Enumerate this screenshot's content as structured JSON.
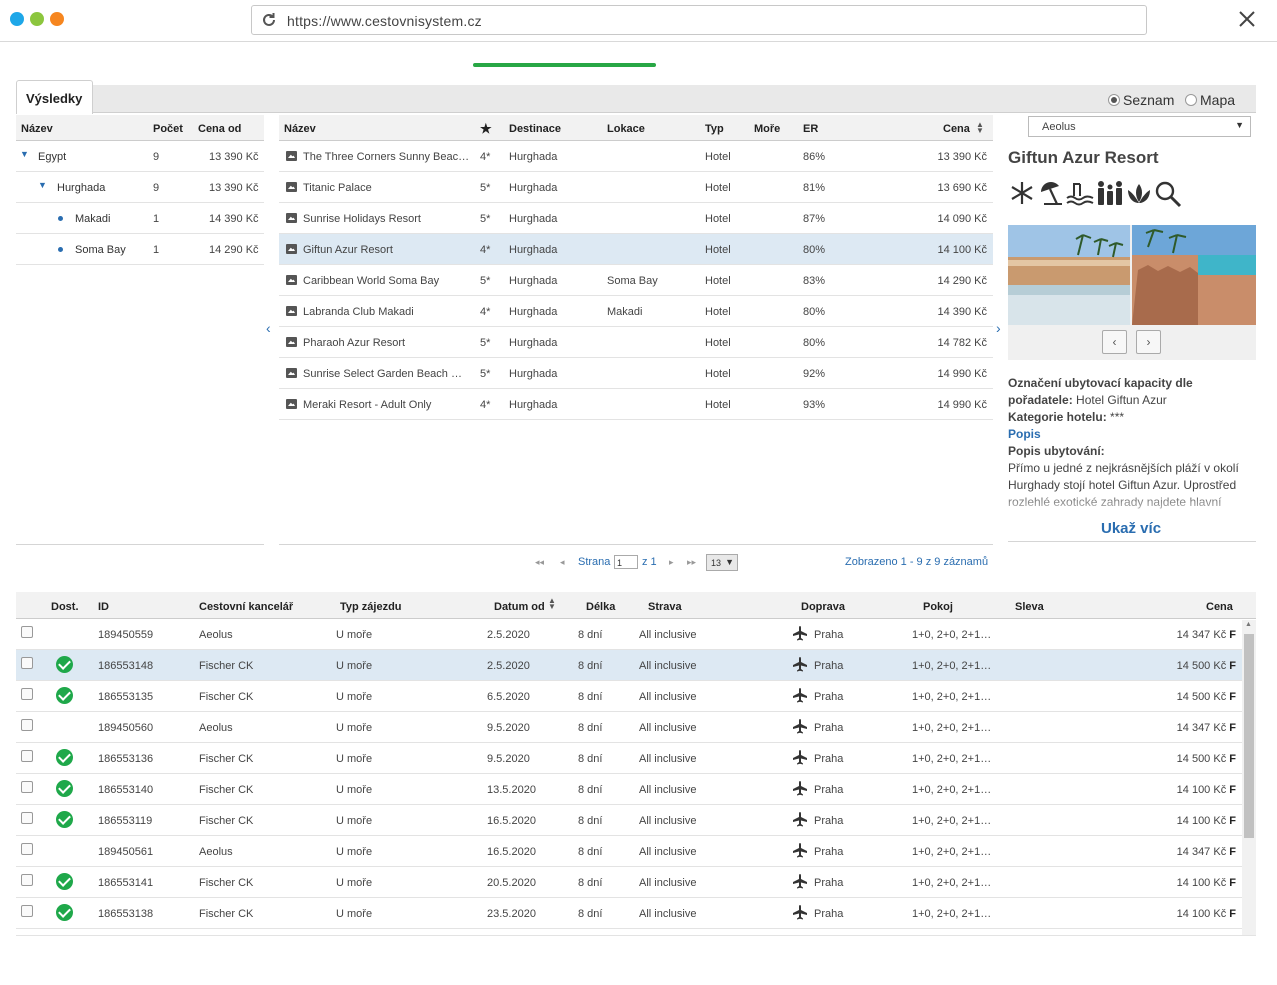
{
  "browser": {
    "url": "https://www.cestovnisystem.cz"
  },
  "tabs": {
    "results": "Výsledky"
  },
  "view": {
    "list": "Seznam",
    "map": "Mapa",
    "selected": "Seznam"
  },
  "destinations": {
    "headers": {
      "name": "Název",
      "count": "Počet",
      "price_from": "Cena od"
    },
    "rows": [
      {
        "name": "Egypt",
        "count": "9",
        "price": "13 390 Kč"
      },
      {
        "name": "Hurghada",
        "count": "9",
        "price": "13 390 Kč"
      },
      {
        "name": "Makadi",
        "count": "1",
        "price": "14 390 Kč"
      },
      {
        "name": "Soma Bay",
        "count": "1",
        "price": "14 290 Kč"
      }
    ]
  },
  "hotels": {
    "headers": {
      "name": "Název",
      "dest": "Destinace",
      "loc": "Lokace",
      "type": "Typ",
      "sea": "Moře",
      "er": "ER",
      "price": "Cena"
    },
    "rows": [
      {
        "name": "The Three Corners Sunny Beac…",
        "stars": "4*",
        "dest": "Hurghada",
        "loc": "",
        "type": "Hotel",
        "er": "86%",
        "price": "13 390 Kč"
      },
      {
        "name": "Titanic Palace",
        "stars": "5*",
        "dest": "Hurghada",
        "loc": "",
        "type": "Hotel",
        "er": "81%",
        "price": "13 690 Kč"
      },
      {
        "name": "Sunrise Holidays Resort",
        "stars": "5*",
        "dest": "Hurghada",
        "loc": "",
        "type": "Hotel",
        "er": "87%",
        "price": "14 090 Kč"
      },
      {
        "name": "Giftun Azur Resort",
        "stars": "4*",
        "dest": "Hurghada",
        "loc": "",
        "type": "Hotel",
        "er": "80%",
        "price": "14 100 Kč"
      },
      {
        "name": "Caribbean World Soma Bay",
        "stars": "5*",
        "dest": "Hurghada",
        "loc": "Soma Bay",
        "type": "Hotel",
        "er": "83%",
        "price": "14 290 Kč"
      },
      {
        "name": "Labranda Club Makadi",
        "stars": "4*",
        "dest": "Hurghada",
        "loc": "Makadi",
        "type": "Hotel",
        "er": "80%",
        "price": "14 390 Kč"
      },
      {
        "name": "Pharaoh Azur Resort",
        "stars": "5*",
        "dest": "Hurghada",
        "loc": "",
        "type": "Hotel",
        "er": "80%",
        "price": "14 782 Kč"
      },
      {
        "name": "Sunrise Select Garden Beach …",
        "stars": "5*",
        "dest": "Hurghada",
        "loc": "",
        "type": "Hotel",
        "er": "92%",
        "price": "14 990 Kč"
      },
      {
        "name": "Meraki Resort - Adult Only",
        "stars": "4*",
        "dest": "Hurghada",
        "loc": "",
        "type": "Hotel",
        "er": "93%",
        "price": "14 990 Kč"
      }
    ]
  },
  "pager": {
    "page_label": "Strana",
    "page_value": "1",
    "of": "z 1",
    "page_size": "13",
    "summary": "Zobrazeno 1 - 9 z 9 záznamů"
  },
  "detail": {
    "operator_select": "Aeolus",
    "hotel_name": "Giftun Azur Resort",
    "amenities": [
      "air-conditioning-icon",
      "beach-umbrella-icon",
      "pool-icon",
      "family-icon",
      "spa-icon",
      "search-magnifier-icon"
    ],
    "label_name": "Označení ubytovací kapacity dle pořadatele",
    "value_name": "Hotel Giftun Azur",
    "label_category": "Kategorie hotelu",
    "value_category": "***",
    "popis_link": "Popis",
    "label_desc": "Popis ubytování:",
    "desc_text": "Přímo u jedné z nejkrásnějších pláží v okolí Hurghady stojí hotel Giftun Azur. Uprostřed rozlehlé exotické zahrady najdete hlavní bufovu, společně s pudlatkou bu bnuon n",
    "show_more": "Ukaž víc"
  },
  "terms": {
    "headers": {
      "avail": "Dost.",
      "id": "ID",
      "agency": "Cestovní kancelář",
      "trip": "Typ zájezdu",
      "date": "Datum od",
      "length": "Délka",
      "board": "Strava",
      "transport": "Doprava",
      "room": "Pokoj",
      "discount": "Sleva",
      "price": "Cena"
    },
    "rows": [
      {
        "ok": false,
        "id": "189450559",
        "agency": "Aeolus",
        "trip": "U moře",
        "date": "2.5.2020",
        "len": "8 dní",
        "board": "All inclusive",
        "from": "Praha",
        "room": "1+0, 2+0, 2+1…",
        "price": "14 347 Kč",
        "flag": "F"
      },
      {
        "ok": true,
        "id": "186553148",
        "agency": "Fischer CK",
        "trip": "U moře",
        "date": "2.5.2020",
        "len": "8 dní",
        "board": "All inclusive",
        "from": "Praha",
        "room": "1+0, 2+0, 2+1…",
        "price": "14 500 Kč",
        "flag": "F"
      },
      {
        "ok": true,
        "id": "186553135",
        "agency": "Fischer CK",
        "trip": "U moře",
        "date": "6.5.2020",
        "len": "8 dní",
        "board": "All inclusive",
        "from": "Praha",
        "room": "1+0, 2+0, 2+1…",
        "price": "14 500 Kč",
        "flag": "F"
      },
      {
        "ok": false,
        "id": "189450560",
        "agency": "Aeolus",
        "trip": "U moře",
        "date": "9.5.2020",
        "len": "8 dní",
        "board": "All inclusive",
        "from": "Praha",
        "room": "1+0, 2+0, 2+1…",
        "price": "14 347 Kč",
        "flag": "F"
      },
      {
        "ok": true,
        "id": "186553136",
        "agency": "Fischer CK",
        "trip": "U moře",
        "date": "9.5.2020",
        "len": "8 dní",
        "board": "All inclusive",
        "from": "Praha",
        "room": "1+0, 2+0, 2+1…",
        "price": "14 500 Kč",
        "flag": "F"
      },
      {
        "ok": true,
        "id": "186553140",
        "agency": "Fischer CK",
        "trip": "U moře",
        "date": "13.5.2020",
        "len": "8 dní",
        "board": "All inclusive",
        "from": "Praha",
        "room": "1+0, 2+0, 2+1…",
        "price": "14 100 Kč",
        "flag": "F"
      },
      {
        "ok": true,
        "id": "186553119",
        "agency": "Fischer CK",
        "trip": "U moře",
        "date": "16.5.2020",
        "len": "8 dní",
        "board": "All inclusive",
        "from": "Praha",
        "room": "1+0, 2+0, 2+1…",
        "price": "14 100 Kč",
        "flag": "F"
      },
      {
        "ok": false,
        "id": "189450561",
        "agency": "Aeolus",
        "trip": "U moře",
        "date": "16.5.2020",
        "len": "8 dní",
        "board": "All inclusive",
        "from": "Praha",
        "room": "1+0, 2+0, 2+1…",
        "price": "14 347 Kč",
        "flag": "F"
      },
      {
        "ok": true,
        "id": "186553141",
        "agency": "Fischer CK",
        "trip": "U moře",
        "date": "20.5.2020",
        "len": "8 dní",
        "board": "All inclusive",
        "from": "Praha",
        "room": "1+0, 2+0, 2+1…",
        "price": "14 100 Kč",
        "flag": "F"
      },
      {
        "ok": true,
        "id": "186553138",
        "agency": "Fischer CK",
        "trip": "U moře",
        "date": "23.5.2020",
        "len": "8 dní",
        "board": "All inclusive",
        "from": "Praha",
        "room": "1+0, 2+0, 2+1…",
        "price": "14 100 Kč",
        "flag": "F"
      }
    ]
  },
  "colors": {
    "accent": "#2a6db0",
    "selected_row": "#dde9f3",
    "available": "#1fa84a",
    "progress": "#28a745"
  }
}
